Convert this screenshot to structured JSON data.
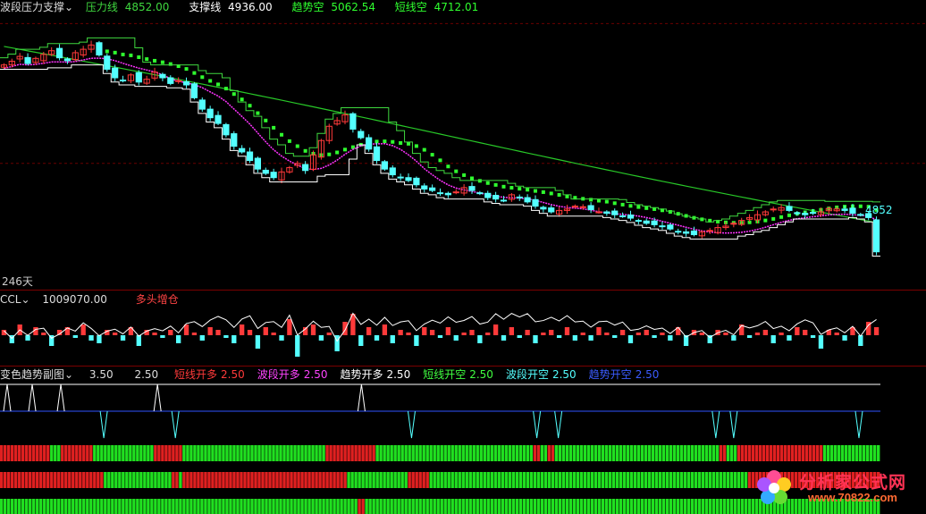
{
  "colors": {
    "up": "#ff3a3a",
    "down": "#54ffff",
    "pressure": "#3fd83f",
    "support": "#ffffff",
    "trend_short": "#2fff2f",
    "trend_long": "#28c828",
    "wave": "#ff33ff",
    "separator": "#7a0000",
    "blue_line": "#2f54ff",
    "bar_red": "#e02020",
    "bar_green": "#20e020"
  },
  "main": {
    "indicator_name": "波段压力支撑",
    "pressure_label": "压力线",
    "pressure_value": "4852.00",
    "support_label": "支撑线",
    "support_value": "4936.00",
    "trend_label": "趋势空",
    "trend_value": "5062.54",
    "short_label": "短线空",
    "short_value": "4712.01",
    "right_price_tag": "4852",
    "days_label": "246天"
  },
  "ccl": {
    "name": "CCL",
    "value": "1009070.00",
    "signal": "多头增仓"
  },
  "sub": {
    "name": "变色趋势副图",
    "v1": "3.50",
    "v2": "2.50",
    "items": [
      {
        "label": "短线开多",
        "value": "2.50",
        "color": "#ff3a3a"
      },
      {
        "label": "波段开多",
        "value": "2.50",
        "color": "#ff44ff"
      },
      {
        "label": "趋势开多",
        "value": "2.50",
        "color": "#ffffff"
      },
      {
        "label": "短线开空",
        "value": "2.50",
        "color": "#40ff40"
      },
      {
        "label": "波段开空",
        "value": "2.50",
        "color": "#54ffff"
      },
      {
        "label": "趋势开空",
        "value": "2.50",
        "color": "#3b5bff"
      }
    ]
  },
  "watermark": {
    "text_cn": "分析家公式网",
    "url": "www.70822.com"
  },
  "chart_data": {
    "type": "candlestick",
    "price_ylim": [
      4580,
      5520
    ],
    "closes": [
      5355,
      5368,
      5385,
      5360,
      5378,
      5392,
      5405,
      5380,
      5370,
      5398,
      5410,
      5425,
      5390,
      5340,
      5310,
      5300,
      5320,
      5295,
      5305,
      5330,
      5310,
      5290,
      5300,
      5285,
      5240,
      5200,
      5170,
      5150,
      5110,
      5070,
      5050,
      5020,
      4990,
      4975,
      4960,
      4980,
      4995,
      5010,
      4985,
      5040,
      5090,
      5140,
      5160,
      5180,
      5130,
      5100,
      5060,
      5020,
      4990,
      4970,
      4960,
      4950,
      4935,
      4920,
      4915,
      4905,
      4900,
      4910,
      4925,
      4915,
      4905,
      4890,
      4885,
      4880,
      4900,
      4890,
      4875,
      4860,
      4850,
      4840,
      4845,
      4850,
      4860,
      4858,
      4848,
      4840,
      4835,
      4830,
      4825,
      4818,
      4808,
      4800,
      4795,
      4790,
      4780,
      4770,
      4765,
      4760,
      4770,
      4775,
      4785,
      4790,
      4800,
      4810,
      4820,
      4830,
      4840,
      4850,
      4855,
      4845,
      4835,
      4830,
      4835,
      4840,
      4852,
      4850,
      4845,
      4835,
      4830,
      4820,
      4700
    ],
    "ccl_values": [
      2,
      -3,
      4,
      -2,
      3,
      1,
      -4,
      2,
      3,
      -1,
      4,
      -2,
      -3,
      2,
      1,
      -2,
      3,
      -4,
      2,
      1,
      -1,
      2,
      -3,
      4,
      1,
      -2,
      3,
      2,
      -1,
      -3,
      4,
      2,
      -5,
      3,
      1,
      -2,
      6,
      -8,
      3,
      4,
      -2,
      1,
      -6,
      5,
      8,
      -4,
      3,
      -2,
      4,
      -3,
      2,
      1,
      -4,
      3,
      2,
      -1,
      3,
      -2,
      1,
      2,
      -3,
      1,
      4,
      -2,
      3,
      -1,
      2,
      -3,
      1,
      2,
      -1,
      3,
      -2,
      1,
      -2,
      3,
      1,
      -1,
      2,
      -3,
      1,
      2,
      -1,
      1,
      -2,
      3,
      -4,
      2,
      1,
      -3,
      2,
      1,
      -2,
      4,
      -1,
      1,
      2,
      -3,
      1,
      -2,
      3,
      2,
      -1,
      -5,
      2,
      1,
      -2,
      3,
      -4,
      5,
      3
    ],
    "signal_spikes_up": [
      2,
      9,
      17,
      44,
      101
    ],
    "signal_spikes_down": [
      29,
      49,
      115,
      150,
      156,
      200,
      205,
      240
    ],
    "bar_rows": [
      [
        [
          0,
          14,
          "r"
        ],
        [
          14,
          17,
          "g"
        ],
        [
          17,
          26,
          "r"
        ],
        [
          26,
          43,
          "g"
        ],
        [
          43,
          51,
          "r"
        ],
        [
          51,
          91,
          "g"
        ],
        [
          91,
          105,
          "r"
        ],
        [
          105,
          149,
          "g"
        ],
        [
          149,
          151,
          "r"
        ],
        [
          151,
          153,
          "g"
        ],
        [
          153,
          155,
          "r"
        ],
        [
          155,
          201,
          "g"
        ],
        [
          201,
          203,
          "r"
        ],
        [
          203,
          206,
          "g"
        ],
        [
          206,
          230,
          "r"
        ],
        [
          230,
          246,
          "g"
        ]
      ],
      [
        [
          0,
          29,
          "r"
        ],
        [
          29,
          48,
          "g"
        ],
        [
          48,
          50,
          "r"
        ],
        [
          50,
          51,
          "g"
        ],
        [
          51,
          97,
          "r"
        ],
        [
          97,
          114,
          "g"
        ],
        [
          114,
          120,
          "r"
        ],
        [
          120,
          209,
          "g"
        ],
        [
          209,
          246,
          "r"
        ]
      ],
      [
        [
          0,
          100,
          "g"
        ],
        [
          100,
          102,
          "r"
        ],
        [
          102,
          246,
          "g"
        ]
      ]
    ]
  }
}
